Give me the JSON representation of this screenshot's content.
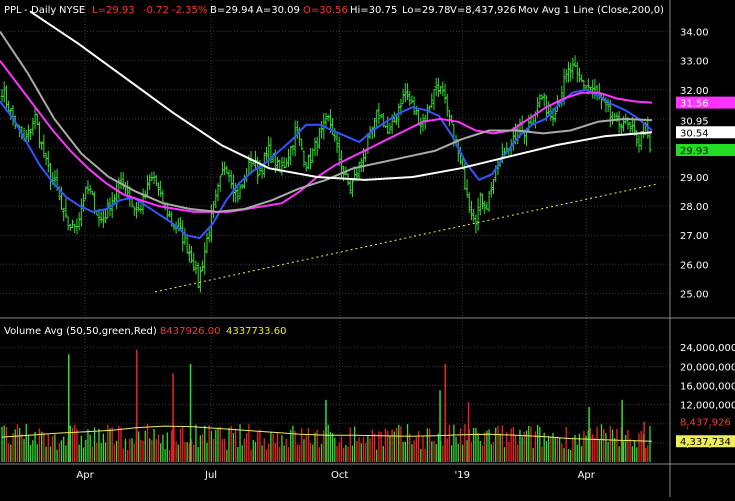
{
  "header": {
    "symbol": "PPL",
    "sep1": " - ",
    "period": "Daily",
    "exchange": "NYSE",
    "last": "L=29.93",
    "change": "-0.72",
    "change_pct": "-2.35%",
    "bid": "B=29.94",
    "ask": "A=30.09",
    "open": "O=30.56",
    "high": "Hi=30.75",
    "low": "Lo=29.78",
    "volume": "V=8,437,926",
    "study": "Mov Avg 1 Line (Close,200,0)"
  },
  "volume_header": {
    "label": "Volume Avg (50,50,green,Red)",
    "value1": "8437926.00",
    "value2": "4337733.60"
  },
  "colors": {
    "background": "#000000",
    "grid": "#3a3a3a",
    "up_bar": "#33dd33",
    "down_bar": "#ee2222",
    "ma_blue": "#3355ff",
    "ma_magenta": "#ff33ff",
    "ma_gray": "#aaaaaa",
    "ma_white": "#ffffff",
    "trendline": "#eeee55",
    "vol_avg": "#eeee66",
    "axis_text": "#ffffff",
    "header_text": "#ffffff",
    "header_neg": "#ff3333",
    "header_yellow": "#eeee00"
  },
  "chart_data": [
    {
      "type": "ohlc",
      "title": "PPL - Daily NYSE",
      "x_ticks": [
        "Apr",
        "Jul",
        "Oct",
        "'19",
        "Apr"
      ],
      "y_ticks": [
        "25.00",
        "26.00",
        "27.00",
        "28.00",
        "29.00",
        "30.00",
        "31.00",
        "32.00",
        "33.00",
        "34.00"
      ],
      "ylim": [
        24.6,
        34.4
      ],
      "price_anchors": {
        "note": "approximate closing path, one value per trading day",
        "values": [
          32.0,
          31.5,
          31.0,
          30.6,
          30.2,
          30.5,
          31.1,
          30.3,
          29.5,
          29.0,
          28.6,
          27.8,
          27.4,
          27.3,
          27.5,
          28.3,
          28.6,
          28.0,
          27.5,
          27.7,
          28.2,
          28.4,
          28.9,
          28.6,
          28.0,
          27.8,
          28.2,
          28.8,
          29.0,
          28.3,
          28.0,
          27.5,
          27.3,
          27.0,
          26.6,
          26.2,
          25.3,
          26.2,
          27.2,
          28.0,
          28.8,
          29.5,
          29.0,
          28.4,
          28.6,
          29.2,
          29.6,
          29.2,
          29.5,
          29.9,
          29.5,
          29.2,
          29.5,
          30.0,
          30.6,
          30.0,
          29.4,
          29.8,
          30.3,
          30.6,
          31.0,
          30.4,
          29.6,
          29.0,
          28.6,
          29.1,
          29.6,
          30.1,
          30.6,
          31.2,
          31.0,
          30.4,
          30.9,
          31.5,
          31.9,
          31.6,
          31.2,
          30.8,
          31.2,
          31.8,
          32.2,
          31.8,
          31.0,
          30.4,
          29.6,
          28.8,
          28.0,
          27.6,
          28.3,
          28.0,
          28.8,
          29.3,
          29.8,
          30.1,
          30.3,
          30.6,
          30.6,
          30.9,
          31.3,
          31.8,
          31.4,
          31.1,
          31.6,
          32.1,
          32.6,
          32.7,
          32.3,
          32.2,
          32.1,
          31.9,
          31.6,
          31.3,
          31.0,
          30.8,
          31.0,
          30.7,
          30.5,
          30.2,
          30.8,
          29.93
        ]
      },
      "moving_averages": [
        {
          "color": "blue",
          "values": [
            31.6,
            31.0,
            30.2,
            29.4,
            28.8,
            28.3,
            28.0,
            27.8,
            27.9,
            28.2,
            28.3,
            28.0,
            27.7,
            27.4,
            27.0,
            26.9,
            27.4,
            28.2,
            28.8,
            29.2,
            29.5,
            29.9,
            30.3,
            30.8,
            30.8,
            30.6,
            30.4,
            30.2,
            30.6,
            30.9,
            31.2,
            31.4,
            31.3,
            31.1,
            30.4,
            29.5,
            28.9,
            29.1,
            29.8,
            30.4,
            30.8,
            31.0,
            31.5,
            31.9,
            32.0,
            31.8,
            31.5,
            31.3,
            31.0,
            30.6
          ]
        },
        {
          "color": "magenta",
          "values": [
            33.0,
            32.2,
            31.4,
            30.6,
            29.9,
            29.3,
            28.8,
            28.4,
            28.2,
            28.0,
            27.9,
            27.8,
            27.8,
            27.8,
            27.9,
            28.0,
            28.1,
            28.5,
            29.0,
            29.4,
            29.7,
            30.0,
            30.3,
            30.6,
            30.9,
            31.0,
            30.9,
            30.6,
            30.5,
            30.6,
            31.0,
            31.4,
            31.7,
            31.9,
            31.9,
            31.7,
            31.6,
            31.56
          ]
        },
        {
          "color": "gray",
          "values": [
            34.0,
            32.6,
            31.0,
            29.8,
            29.0,
            28.5,
            28.1,
            27.9,
            27.8,
            27.9,
            28.2,
            28.6,
            28.9,
            29.3,
            29.5,
            29.7,
            29.9,
            30.3,
            30.6,
            30.6,
            30.5,
            30.6,
            30.9,
            31.0,
            30.95
          ]
        },
        {
          "color": "white",
          "values": [
            34.7,
            33.6,
            32.4,
            31.2,
            30.1,
            29.3,
            29.0,
            28.9,
            29.0,
            29.3,
            29.7,
            30.1,
            30.4,
            30.54
          ]
        }
      ],
      "trendline": {
        "from": 25.05,
        "to": 28.75
      },
      "price_labels": [
        {
          "value": 31.56,
          "text": "31.56",
          "bg": "#ff33ff",
          "fg": "#ffffff"
        },
        {
          "value": 30.95,
          "text": "30.95",
          "bg": "#000000",
          "fg": "#ffffff"
        },
        {
          "value": 30.54,
          "text": "30.54",
          "bg": "#ffffff",
          "fg": "#000000"
        },
        {
          "value": 29.93,
          "text": "29.93",
          "bg": "#22dd22",
          "fg": "#000000"
        }
      ]
    },
    {
      "type": "bar",
      "title": "Volume Avg (50,50,green,Red)",
      "y_ticks": [
        "4,000,000",
        "8,000,000",
        "12,000,000",
        "16,000,000",
        "20,000,000",
        "24,000,000"
      ],
      "ylim": [
        0,
        25500000
      ],
      "spikes": [
        {
          "pos": 0.103,
          "value": 22500000,
          "color": "green"
        },
        {
          "pos": 0.208,
          "value": 23500000,
          "color": "red"
        },
        {
          "pos": 0.264,
          "value": 18500000,
          "color": "red"
        },
        {
          "pos": 0.291,
          "value": 20500000,
          "color": "green"
        },
        {
          "pos": 0.5,
          "value": 13000000,
          "color": "green"
        },
        {
          "pos": 0.676,
          "value": 15000000,
          "color": "green"
        },
        {
          "pos": 0.684,
          "value": 20500000,
          "color": "red"
        },
        {
          "pos": 0.72,
          "value": 12500000,
          "color": "red"
        },
        {
          "pos": 0.906,
          "value": 11500000,
          "color": "green"
        },
        {
          "pos": 0.957,
          "value": 13000000,
          "color": "green"
        },
        {
          "pos": 0.991,
          "value": 8437926,
          "color": "red"
        }
      ],
      "avg_values": [
        5200000,
        5600000,
        6000000,
        6300000,
        6600000,
        7200000,
        7500000,
        7400000,
        7000000,
        6600000,
        6200000,
        5800000,
        5600000,
        5600000,
        5500000,
        5400000,
        5500000,
        5700000,
        5800000,
        5600000,
        5300000,
        4900000,
        4700000,
        4500000,
        4337733
      ],
      "price_labels": [
        {
          "value": 8437926,
          "text": "8,437,926",
          "bg": "#000000",
          "fg": "#ff3333"
        },
        {
          "value": 4337733,
          "text": "4,337,734",
          "bg": "#eeee55",
          "fg": "#000000"
        }
      ]
    }
  ]
}
